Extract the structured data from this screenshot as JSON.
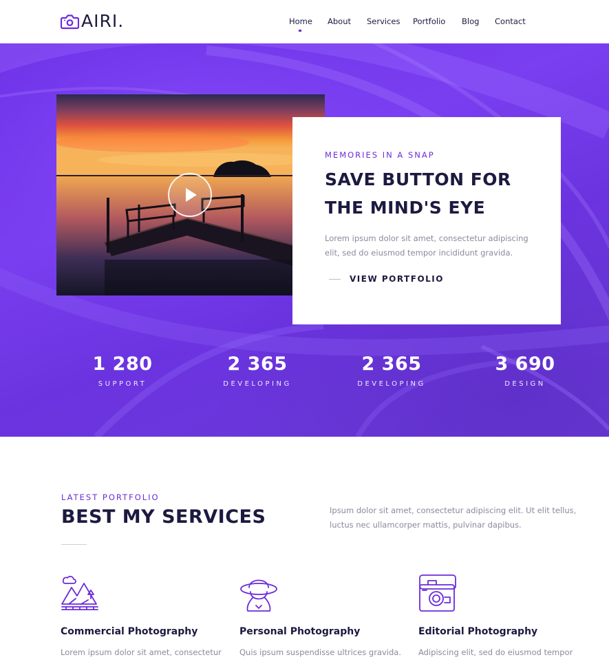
{
  "brand": {
    "name": "AIRI."
  },
  "nav": {
    "items": [
      {
        "label": "Home",
        "active": true
      },
      {
        "label": "About"
      },
      {
        "label": "Services"
      },
      {
        "label": "Portfolio"
      },
      {
        "label": "Blog"
      },
      {
        "label": "Contact"
      }
    ]
  },
  "hero": {
    "eyebrow": "MEMORIES IN A SNAP",
    "title": "SAVE BUTTON FOR THE MIND'S EYE",
    "description": "Lorem ipsum dolor sit amet, consectetur adipiscing elit, sed do eiusmod tempor incididunt gravida.",
    "link_label": "VIEW PORTFOLIO",
    "stats": [
      {
        "value": "1 280",
        "label": "SUPPORT"
      },
      {
        "value": "2 365",
        "label": "DEVELOPING"
      },
      {
        "value": "2 365",
        "label": "DEVELOPING"
      },
      {
        "value": "3 690",
        "label": "DESIGN"
      }
    ]
  },
  "services_section": {
    "eyebrow": "LATEST PORTFOLIO",
    "title": "BEST MY SERVICES",
    "description": "Ipsum dolor sit amet, consectetur adipiscing elit. Ut elit tellus, luctus nec ullamcorper mattis, pulvinar dapibus.",
    "items": [
      {
        "icon": "mountain-landscape-icon",
        "title": "Commercial Photography",
        "text": "Lorem ipsum dolor sit amet, consectetur"
      },
      {
        "icon": "woman-hat-icon",
        "title": "Personal Photography",
        "text": "Quis ipsum suspendisse ultrices gravida."
      },
      {
        "icon": "retro-camera-icon",
        "title": "Editorial Photography",
        "text": "Adipiscing elit, sed do eiusmod tempor"
      }
    ]
  },
  "colors": {
    "accent": "#6c2bd9",
    "dark": "#1c1a3f",
    "muted": "#8a8a9e"
  }
}
